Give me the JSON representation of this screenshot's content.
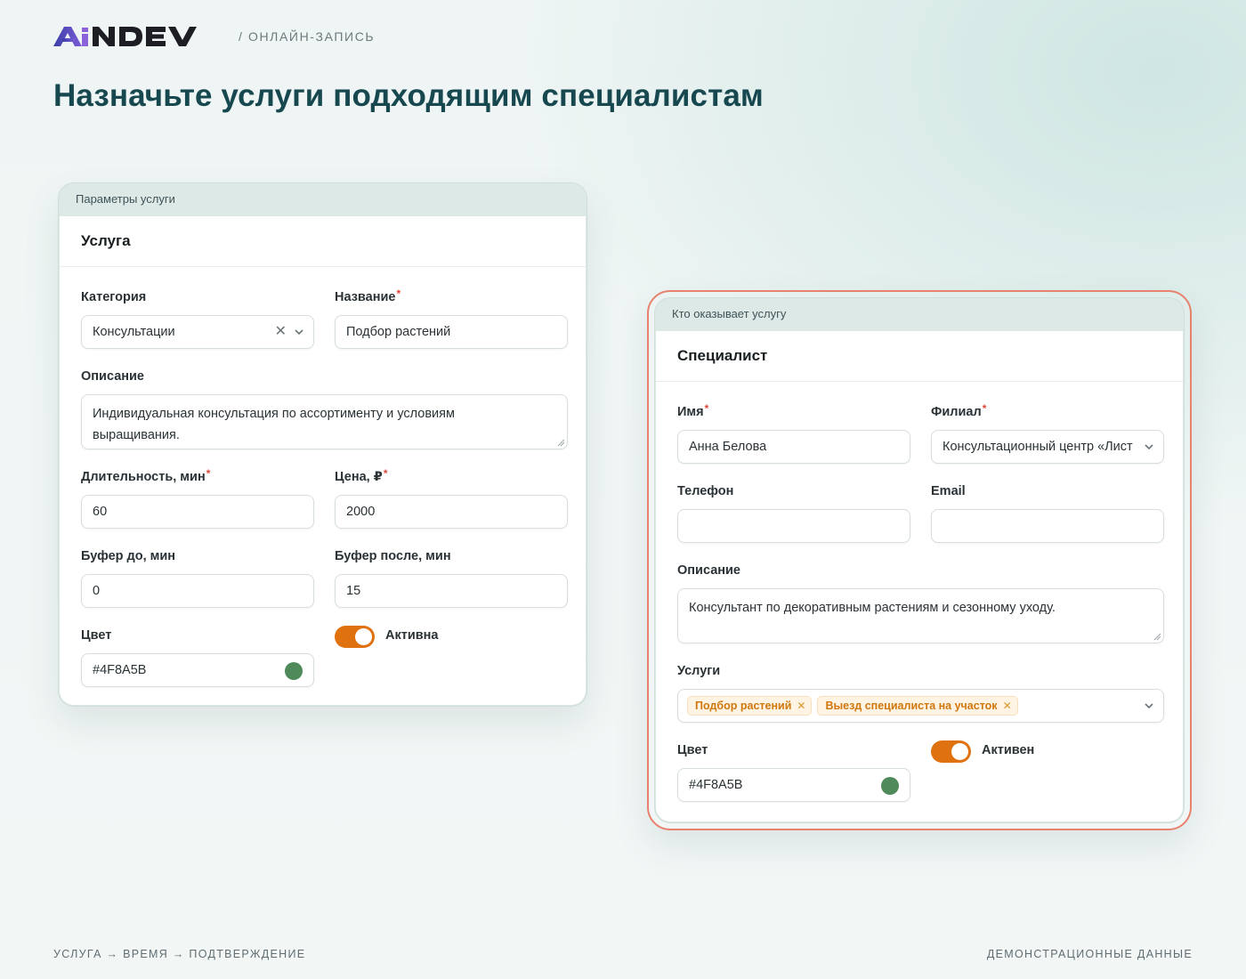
{
  "header": {
    "logo_text": "AiNDEV",
    "section": "/ ОНЛАЙН-ЗАПИСЬ",
    "title": "Назначьте услуги подходящим специалистам"
  },
  "service_card": {
    "tab_label": "Параметры услуги",
    "heading": "Услуга",
    "category": {
      "label": "Категория",
      "value": "Консультации"
    },
    "name": {
      "label": "Название",
      "value": "Подбор растений"
    },
    "description": {
      "label": "Описание",
      "line1": "Индивидуальная консультация по ассортименту и условиям",
      "line2": "выращивания."
    },
    "duration": {
      "label": "Длительность, мин",
      "value": "60"
    },
    "price": {
      "label": "Цена, ₽",
      "value": "2000"
    },
    "buffer_before": {
      "label": "Буфер до, мин",
      "value": "0"
    },
    "buffer_after": {
      "label": "Буфер после, мин",
      "value": "15"
    },
    "color": {
      "label": "Цвет",
      "value": "#4F8A5B",
      "swatch": "#4f8a5b"
    },
    "active": {
      "label": "Активна",
      "on": true
    }
  },
  "specialist_card": {
    "tab_label": "Кто оказывает услугу",
    "heading": "Специалист",
    "name": {
      "label": "Имя",
      "value": "Анна Белова"
    },
    "branch": {
      "label": "Филиал",
      "value": "Консультационный центр «Лист"
    },
    "phone": {
      "label": "Телефон",
      "value": ""
    },
    "email": {
      "label": "Email",
      "value": ""
    },
    "description": {
      "label": "Описание",
      "value": "Консультант по декоративным растениям и сезонному уходу."
    },
    "services": {
      "label": "Услуги",
      "tags": [
        "Подбор растений",
        "Выезд специалиста на участок"
      ]
    },
    "color": {
      "label": "Цвет",
      "value": "#4F8A5B",
      "swatch": "#4f8a5b"
    },
    "active": {
      "label": "Активен",
      "on": true
    }
  },
  "footer": {
    "steps": "УСЛУГА → ВРЕМЯ → ПОДТВЕРЖДЕНИЕ",
    "note": "ДЕМОНСТРАЦИОННЫЕ ДАННЫЕ"
  },
  "colors": {
    "accent_toggle": "#e0710f",
    "highlight_border": "#e8816d",
    "title": "#17474f",
    "tag_bg": "#fff4e3",
    "tag_text": "#d0770e"
  }
}
